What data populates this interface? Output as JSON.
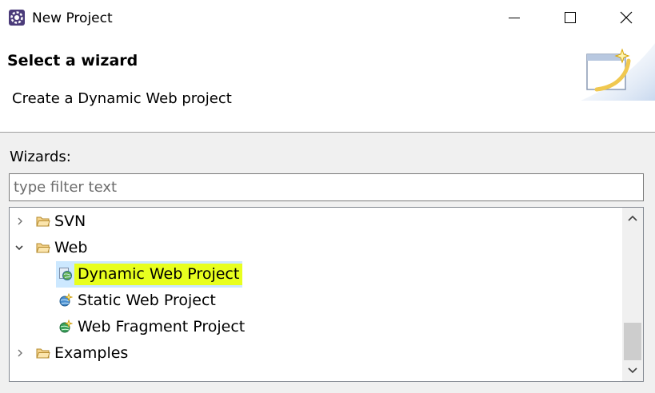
{
  "window": {
    "title": "New Project",
    "app_icon": "eclipse-gear-icon",
    "buttons": {
      "minimize": "minimize-icon",
      "maximize": "maximize-icon",
      "close": "close-icon"
    }
  },
  "header": {
    "title": "Select a wizard",
    "description": "Create a Dynamic Web project",
    "banner_icon": "new-wizard-icon"
  },
  "body": {
    "wizards_label": "Wizards:",
    "filter": {
      "value": "",
      "placeholder": "type filter text"
    }
  },
  "tree": {
    "items": [
      {
        "label": "SVN",
        "expanded": false,
        "icon": "folder-icon",
        "level": 0
      },
      {
        "label": "Web",
        "expanded": true,
        "icon": "folder-icon",
        "level": 0
      },
      {
        "label": "Dynamic Web Project",
        "icon": "dynamic-web-project-icon",
        "level": 1,
        "selected": true,
        "highlighted": true
      },
      {
        "label": "Static Web Project",
        "icon": "static-web-project-icon",
        "level": 1
      },
      {
        "label": "Web Fragment Project",
        "icon": "web-fragment-project-icon",
        "level": 1
      },
      {
        "label": "Examples",
        "expanded": false,
        "icon": "folder-icon",
        "level": 0
      }
    ]
  },
  "colors": {
    "selection": "#cce8ff",
    "highlight": "#e8ff1f",
    "header_background": "#ffffff",
    "dialog_background": "#f0f0f0"
  }
}
